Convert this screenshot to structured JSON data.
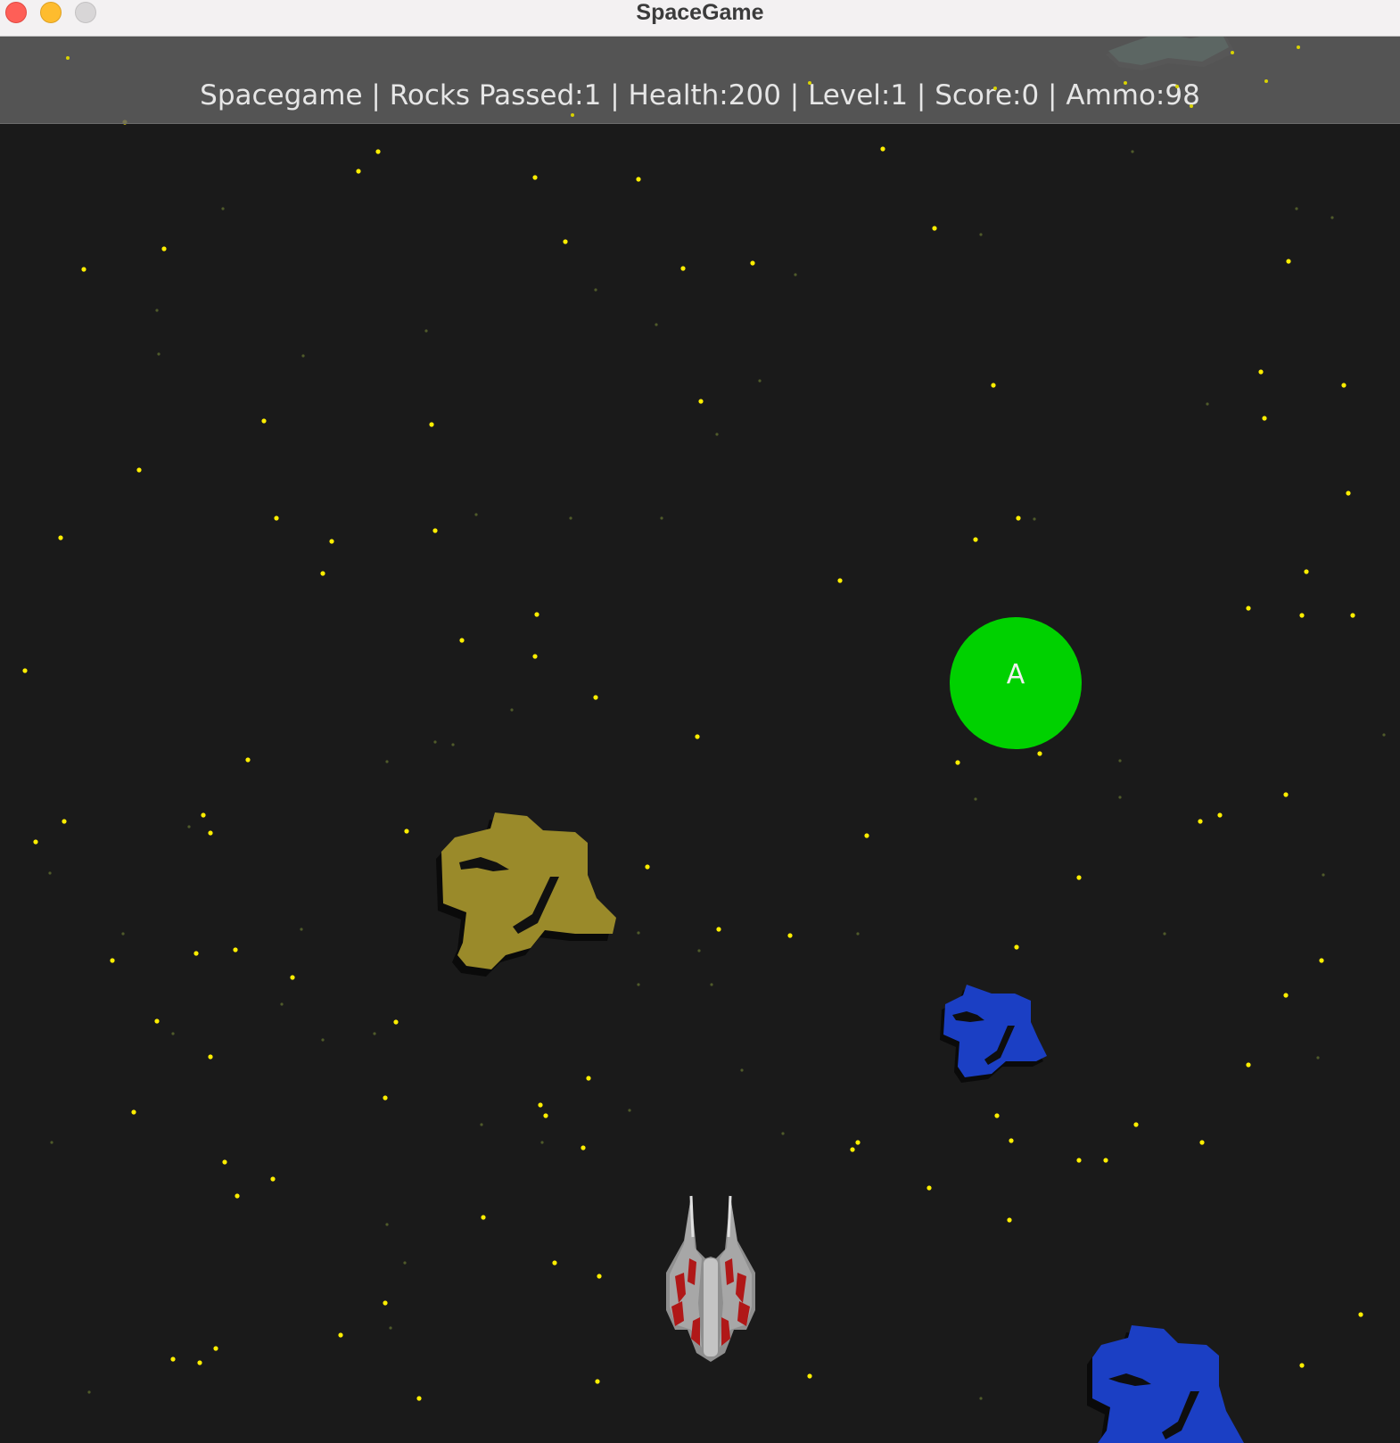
{
  "window": {
    "title": "SpaceGame"
  },
  "hud": {
    "text": "Spacegame | Rocks Passed:1 | Health:200 | Level:1 | Score:0 | Ammo:98",
    "game_name": "Spacegame",
    "rocks_passed": 1,
    "health": 200,
    "level": 1,
    "score": 0,
    "ammo": 98
  },
  "powerup": {
    "label": "A",
    "color": "#00d100"
  },
  "colors": {
    "background": "#1a1a1a",
    "star": "#ffee00",
    "rock_gold": "#9a8a2a",
    "rock_blue": "#1b3fc4",
    "rock_teal": "#4e8f7a",
    "ship_hull": "#a7a7a7",
    "ship_trim": "#b01818"
  },
  "icons": {
    "window_close": "close-icon",
    "window_minimize": "minimize-icon",
    "window_maximize": "maximize-icon",
    "player": "spaceship-icon",
    "rocks": "asteroid-icon"
  }
}
